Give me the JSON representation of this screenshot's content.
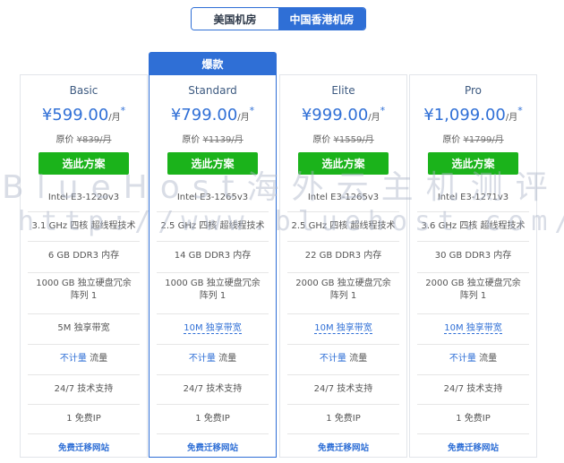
{
  "tabs": [
    {
      "label": "美国机房"
    },
    {
      "label": "中国香港机房"
    }
  ],
  "badge": "爆款",
  "currency": "¥",
  "per_month": "/月",
  "asterisk": "*",
  "orig_label": "原价",
  "select_label": "选此方案",
  "plans": [
    {
      "name": "Basic",
      "price": "599.00",
      "orig": "¥839/月",
      "cpu": "Intel E3-1220v3",
      "freq": "3.1 GHz 四核 超线程技术",
      "ram": "6 GB DDR3 内存",
      "disk_line1": "1000 GB 独立硬盘冗余",
      "disk_line2": "阵列 1",
      "bw": "5M 独享带宽",
      "traffic_a": "不计量",
      "traffic_b": " 流量",
      "support": "24/7 技术支持",
      "ip_a": "1 免费",
      "ip_b": "IP",
      "migrate": "免费迁移网站"
    },
    {
      "name": "Standard",
      "price": "799.00",
      "orig": "¥1139/月",
      "cpu": "Intel E3-1265v3",
      "freq": "2.5 GHz 四核 超线程技术",
      "ram": "14 GB DDR3 内存",
      "disk_line1": "1000 GB 独立硬盘冗余",
      "disk_line2": "阵列 1",
      "bw": "10M 独享带宽",
      "traffic_a": "不计量",
      "traffic_b": " 流量",
      "support": "24/7 技术支持",
      "ip_a": "1 免费",
      "ip_b": "IP",
      "migrate": "免费迁移网站"
    },
    {
      "name": "Elite",
      "price": "999.00",
      "orig": "¥1559/月",
      "cpu": "Intel E3-1265v3",
      "freq": "2.5 GHz 四核 超线程技术",
      "ram": "22 GB DDR3 内存",
      "disk_line1": "2000 GB 独立硬盘冗余",
      "disk_line2": "阵列 1",
      "bw": "10M 独享带宽",
      "traffic_a": "不计量",
      "traffic_b": " 流量",
      "support": "24/7 技术支持",
      "ip_a": "1 免费",
      "ip_b": "IP",
      "migrate": "免费迁移网站"
    },
    {
      "name": "Pro",
      "price": "1,099.00",
      "orig": "¥1799/月",
      "cpu": "Intel E3-1271v3",
      "freq": "3.6 GHz 四核 超线程技术",
      "ram": "30 GB DDR3 内存",
      "disk_line1": "2000 GB 独立硬盘冗余",
      "disk_line2": "阵列 1",
      "bw": "10M 独享带宽",
      "traffic_a": "不计量",
      "traffic_b": " 流量",
      "support": "24/7 技术支持",
      "ip_a": "1 免费",
      "ip_b": "IP",
      "migrate": "免费迁移网站"
    }
  ],
  "watermark": {
    "line1": "BlueHost海外云主机测评",
    "line2": "http://www.bluehost.com/"
  },
  "colors": {
    "accent": "#2f6fd6",
    "button": "#1bb31b"
  }
}
